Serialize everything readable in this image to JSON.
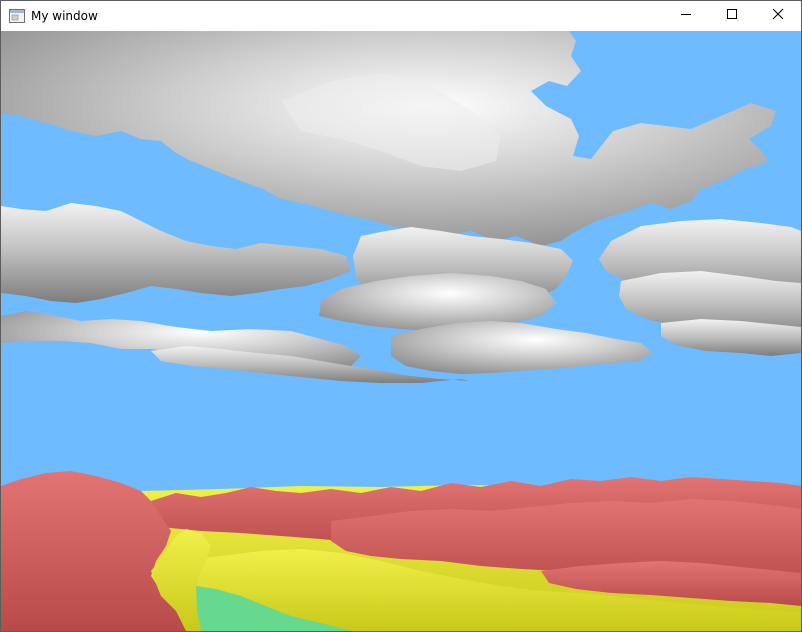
{
  "window": {
    "title": "My window",
    "controls": {
      "minimize_icon": "minimize-icon",
      "maximize_icon": "maximize-icon",
      "close_icon": "close-icon"
    }
  },
  "scene": {
    "sky_color": "#6ebcff",
    "cloud_color": "#c9c9c9",
    "terrain_high_color": "#d96060",
    "terrain_mid_color": "#e7e72a",
    "terrain_low_color": "#66d98f"
  }
}
